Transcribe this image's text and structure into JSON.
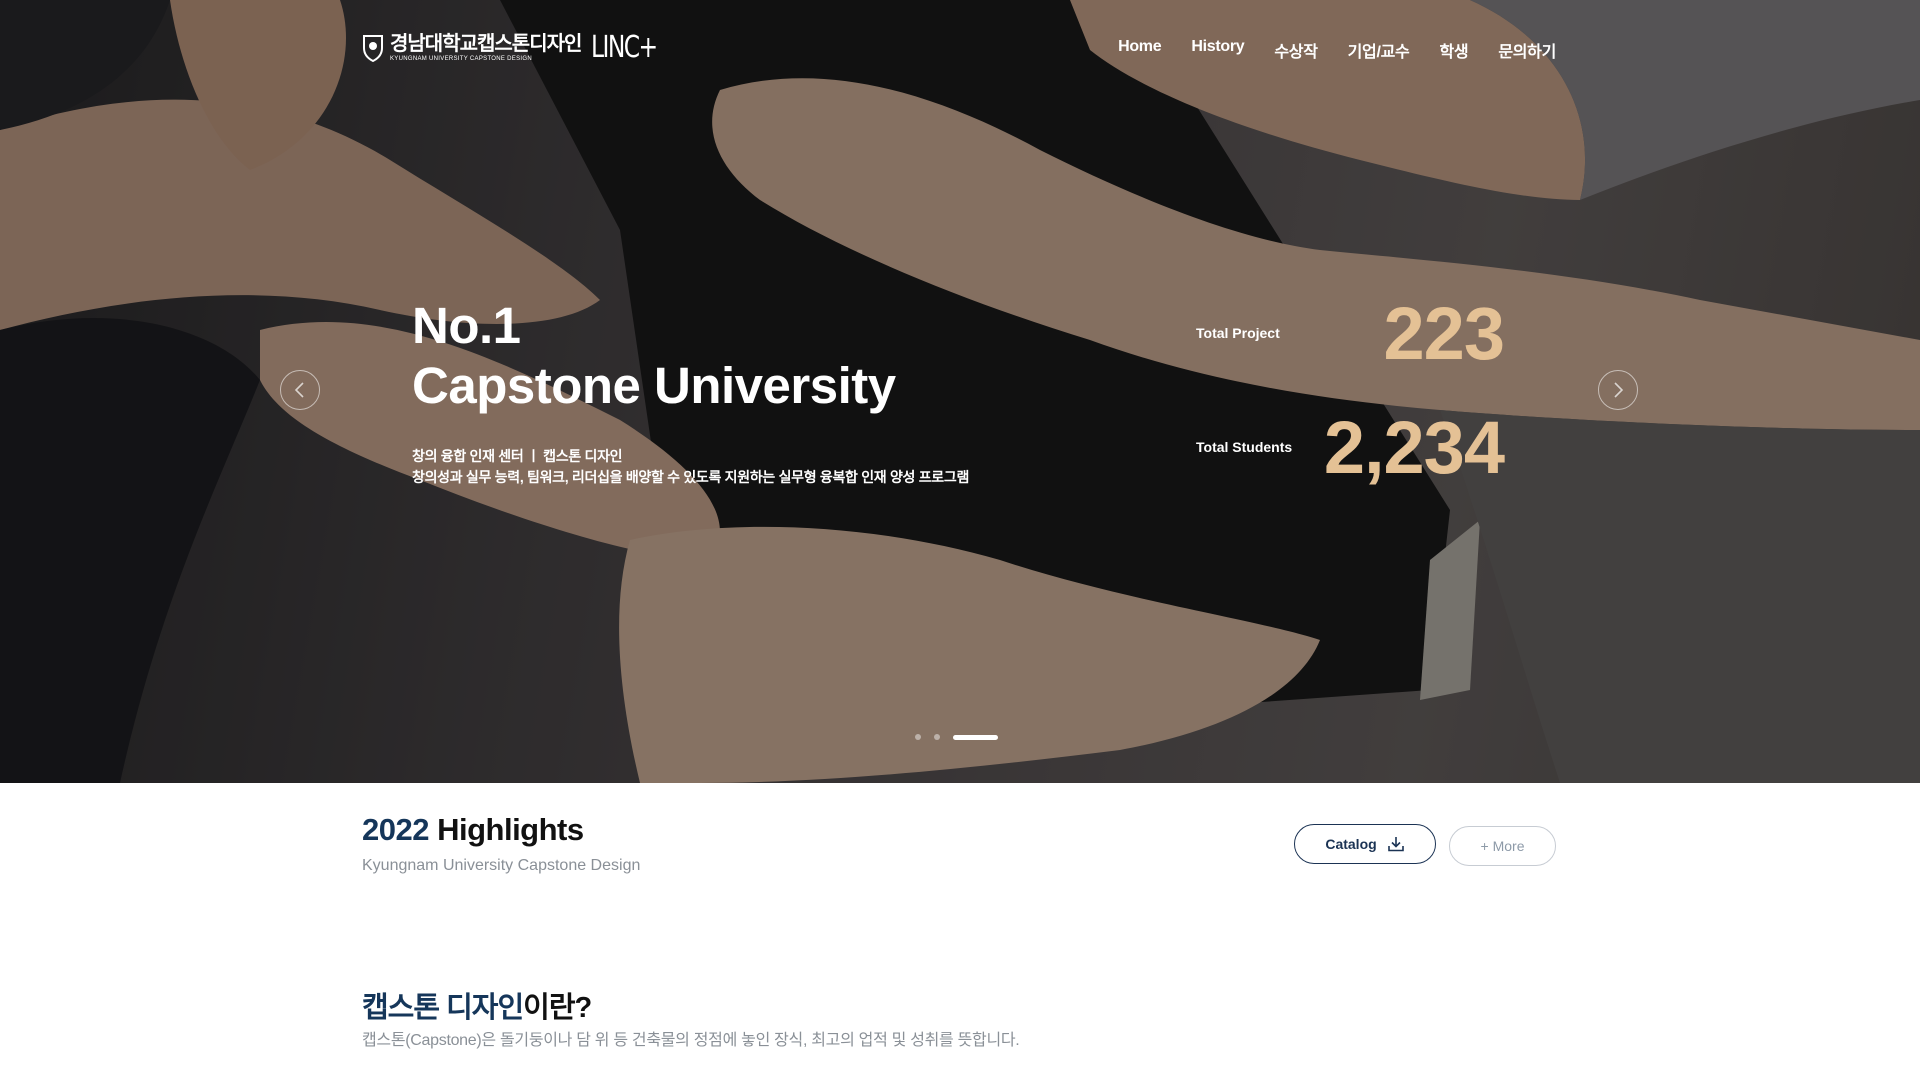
{
  "header": {
    "logo_ko": "경남대학교캡스톤디자인",
    "logo_en": "KYUNGNAM UNIVERSITY CAPSTONE DESIGN",
    "logo_linc": "LINC+",
    "nav": [
      "Home",
      "History",
      "수상작",
      "기업/교수",
      "학생",
      "문의하기"
    ]
  },
  "hero": {
    "headline_line1": "No.1",
    "headline_line2": "Capstone University",
    "sub_line1": "창의 융합 인재 센터  ㅣ  캡스톤 디자인",
    "sub_line2": "창의성과 실무 능력, 팀워크, 리더십을 배양할 수 있도록 지원하는 실무형 융복합 인재 양성 프로그램",
    "stats": [
      {
        "label": "Total Project",
        "value": "223"
      },
      {
        "label": "Total Students",
        "value": "2,234"
      }
    ],
    "slider": {
      "slide_count": 3,
      "active_index": 2
    }
  },
  "highlights": {
    "title_year": "2022",
    "title_rest": " Highlights",
    "subtitle": "Kyungnam University Capstone Design",
    "catalog_label": "Catalog",
    "more_label": "+ More"
  },
  "intro": {
    "title_highlight": "캡스톤 디자인",
    "title_rest": "이란?",
    "description": "캡스톤(Capstone)은 돌기둥이나 담 위 등 건축물의 정점에 놓인 장식, 최고의 업적 및 성취를 뜻합니다."
  },
  "colors": {
    "accent_navy": "#15365a",
    "stat_gold": "#e4c195"
  },
  "icons": {
    "emblem": "university-emblem-icon",
    "catalog": "download-icon",
    "prev": "chevron-left-icon",
    "next": "chevron-right-icon"
  }
}
